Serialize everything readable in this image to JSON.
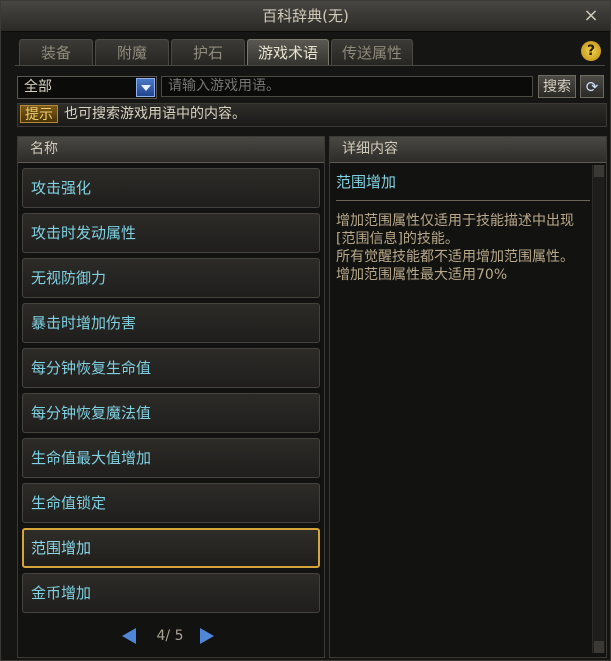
{
  "window": {
    "title": "百科辞典(无)",
    "close_icon": "×"
  },
  "tabs": [
    {
      "label": "装备"
    },
    {
      "label": "附魔"
    },
    {
      "label": "护石"
    },
    {
      "label": "游戏术语"
    },
    {
      "label": "传送属性"
    }
  ],
  "help_icon": "?",
  "filter": {
    "selected": "全部"
  },
  "search": {
    "placeholder": "请输入游戏用语。",
    "button": "搜索",
    "refresh_icon": "⟳"
  },
  "hint": {
    "tag": "提示",
    "text": "也可搜索游戏用语中的内容。"
  },
  "list": {
    "header": "名称",
    "items": [
      {
        "label": "攻击强化"
      },
      {
        "label": "攻击时发动属性"
      },
      {
        "label": "无视防御力"
      },
      {
        "label": "暴击时增加伤害"
      },
      {
        "label": "每分钟恢复生命值"
      },
      {
        "label": "每分钟恢复魔法值"
      },
      {
        "label": "生命值最大值增加"
      },
      {
        "label": "生命值锁定"
      },
      {
        "label": "范围增加"
      },
      {
        "label": "金币增加"
      }
    ],
    "selected_index": 8,
    "pager": "4/ 5"
  },
  "detail": {
    "header": "详细内容",
    "title": "范围增加",
    "lines": [
      "增加范围属性仅适用于技能描述中出现[范围信息]的技能。",
      "所有觉醒技能都不适用增加范围属性。",
      "增加范围属性最大适用70%"
    ]
  }
}
